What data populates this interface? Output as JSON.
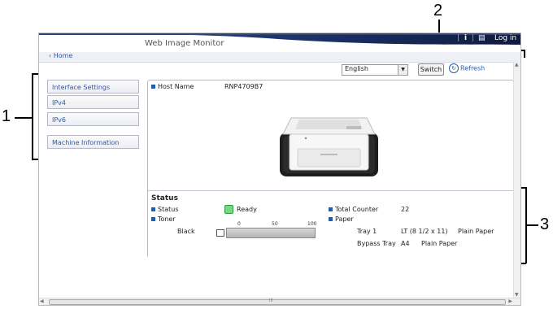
{
  "callouts": [
    "1",
    "2",
    "3"
  ],
  "header": {
    "app_title": "Web Image Monitor",
    "info_icon": "i",
    "login_label": "Log in"
  },
  "nav": {
    "home": "Home"
  },
  "toolbar": {
    "language_value": "English",
    "switch_label": "Switch",
    "refresh_label": "Refresh"
  },
  "sidebar": {
    "items": [
      {
        "label": "Interface Settings"
      },
      {
        "label": "IPv4"
      },
      {
        "label": "IPv6"
      },
      {
        "label": "Machine Information"
      }
    ]
  },
  "device": {
    "host_name_label": "Host Name",
    "host_name_value": "RNP4709B7"
  },
  "status": {
    "title": "Status",
    "status_label": "Status",
    "status_value": "Ready",
    "toner_label": "Toner",
    "toner_color": "Black",
    "toner_scale": [
      "0",
      "50",
      "100"
    ],
    "toner_level": 1.0,
    "total_counter_label": "Total Counter",
    "total_counter_value": "22",
    "paper_label": "Paper",
    "tray1_label": "Tray 1",
    "tray1_size": "LT (8 1/2 x 11)",
    "tray1_type": "Plain Paper",
    "bypass_label": "Bypass Tray",
    "bypass_size": "A4",
    "bypass_type": "Plain Paper"
  },
  "scroll": {
    "h_thumb": "III"
  },
  "colors": {
    "accent": "#2d5ca8",
    "header_dark": "#0f1b3d",
    "ready_green": "#2a9d3c"
  }
}
